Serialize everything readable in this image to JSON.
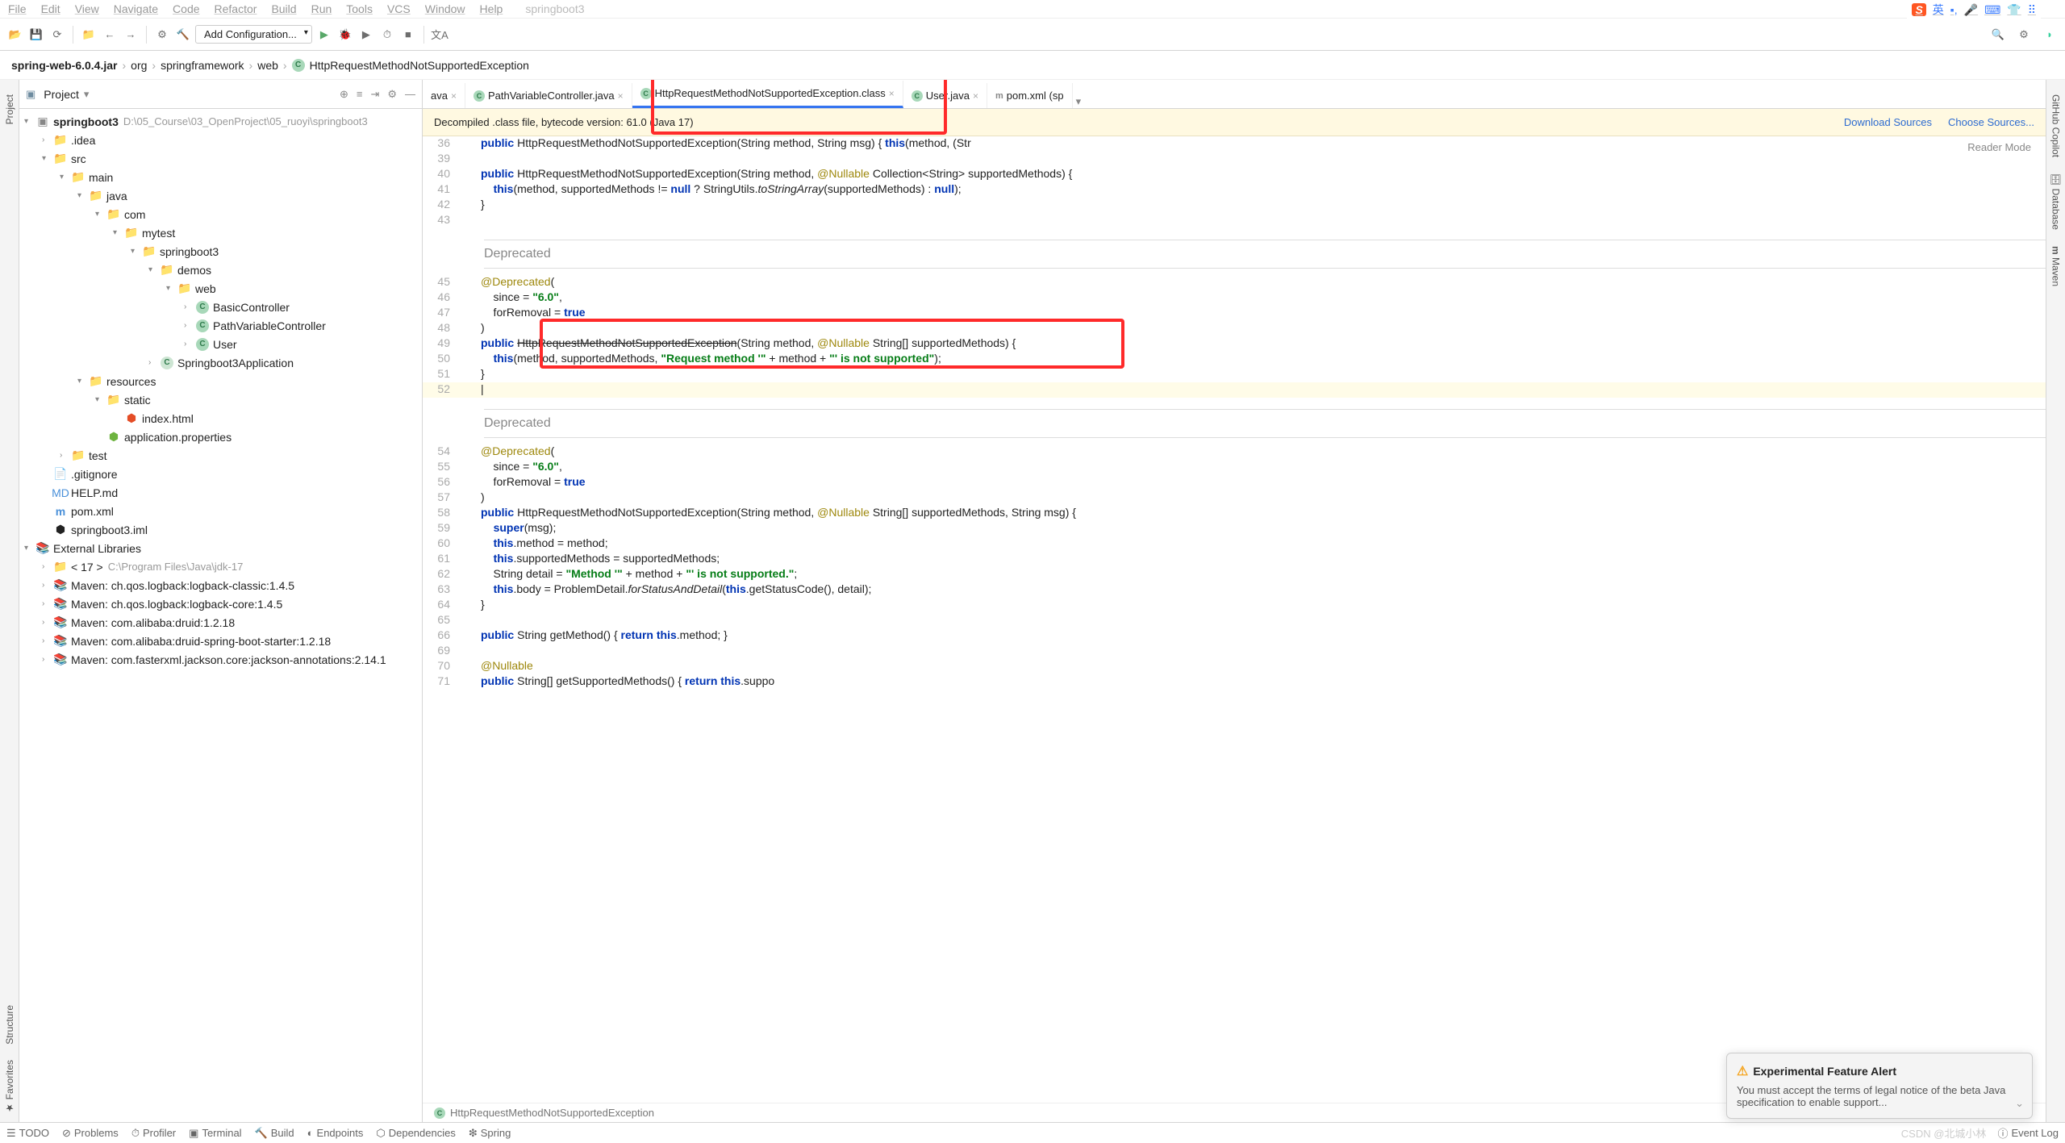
{
  "menubar": [
    "File",
    "Edit",
    "View",
    "Navigate",
    "Code",
    "Refactor",
    "Build",
    "Run",
    "Tools",
    "VCS",
    "Window",
    "Help"
  ],
  "menubar_title": "springboot3",
  "toolbar": {
    "config_label": "Add Configuration..."
  },
  "breadcrumb": [
    "spring-web-6.0.4.jar",
    "org",
    "springframework",
    "web"
  ],
  "breadcrumb_class": "HttpRequestMethodNotSupportedException",
  "panel": {
    "title": "Project"
  },
  "tree": {
    "root": "springboot3",
    "root_hint": "D:\\05_Course\\03_OpenProject\\05_ruoyi\\springboot3",
    "idea": ".idea",
    "src": "src",
    "main": "main",
    "java": "java",
    "com": "com",
    "mytest": "mytest",
    "sb3": "springboot3",
    "demos": "demos",
    "web": "web",
    "basic": "BasicController",
    "pathvar": "PathVariableController",
    "user": "User",
    "app": "Springboot3Application",
    "resources": "resources",
    "static": "static",
    "index": "index.html",
    "appprops": "application.properties",
    "test": "test",
    "gitignore": ".gitignore",
    "help": "HELP.md",
    "pom": "pom.xml",
    "iml": "springboot3.iml",
    "extlib": "External Libraries",
    "jdk": "< 17 >",
    "jdk_hint": "C:\\Program Files\\Java\\jdk-17",
    "m1": "Maven: ch.qos.logback:logback-classic:1.4.5",
    "m2": "Maven: ch.qos.logback:logback-core:1.4.5",
    "m3": "Maven: com.alibaba:druid:1.2.18",
    "m4": "Maven: com.alibaba:druid-spring-boot-starter:1.2.18",
    "m5": "Maven: com.fasterxml.jackson.core:jackson-annotations:2.14.1"
  },
  "tabs": {
    "t0": "ava",
    "t1": "PathVariableController.java",
    "t2": "HttpRequestMethodNotSupportedException.class",
    "t3": "User.java",
    "t4": "pom.xml (sp"
  },
  "banner": {
    "text_prefix": "Decompiled .class file, bytecode version: ",
    "text_version": "61.0 (Java 17)",
    "link1": "Download Sources",
    "link2": "Choose Sources..."
  },
  "reader_mode": "Reader Mode",
  "code_lines": {
    "36": "        public HttpRequestMethodNotSupportedException(String method, String msg) { this(method, (Str",
    "39": "",
    "40": "        public HttpRequestMethodNotSupportedException(String method, @Nullable Collection<String> supportedMethods) {",
    "41": "            this(method, supportedMethods != null ? StringUtils.toStringArray(supportedMethods) : null);",
    "42": "        }",
    "43": "",
    "dep1": "Deprecated",
    "45": "        @Deprecated(",
    "46": "            since = \"6.0\",",
    "47": "            forRemoval = true",
    "48": "        )",
    "49": "        public HttpRequestMethodNotSupportedException(String method, @Nullable String[] supportedMethods) {",
    "50": "            this(method, supportedMethods, \"Request method '\" + method + \"' is not supported\");",
    "51": "        }",
    "52": "",
    "dep2": "Deprecated",
    "54": "        @Deprecated(",
    "55": "            since = \"6.0\",",
    "56": "            forRemoval = true",
    "57": "        )",
    "58": "        public HttpRequestMethodNotSupportedException(String method, @Nullable String[] supportedMethods, String msg) {",
    "59": "            super(msg);",
    "60": "            this.method = method;",
    "61": "            this.supportedMethods = supportedMethods;",
    "62": "            String detail = \"Method '\" + method + \"' is not supported.\";",
    "63": "            this.body = ProblemDetail.forStatusAndDetail(this.getStatusCode(), detail);",
    "64": "        }",
    "65": "",
    "66": "        public String getMethod() { return this.method; }",
    "69": "",
    "70": "        @Nullable",
    "71": "        public String[] getSupportedMethods() { return this.suppo"
  },
  "editor_breadcrumb": "HttpRequestMethodNotSupportedException",
  "popup": {
    "title": "Experimental Feature Alert",
    "body": "You must accept the terms of legal notice of the beta Java specification to enable support..."
  },
  "statusbar": {
    "todo": "TODO",
    "problems": "Problems",
    "profiler": "Profiler",
    "terminal": "Terminal",
    "build": "Build",
    "endpoints": "Endpoints",
    "deps": "Dependencies",
    "spring": "Spring",
    "eventlog": "Event Log"
  },
  "watermark": "CSDN @北城小林",
  "right_panels": [
    "GitHub Copilot",
    "Database",
    "Maven"
  ],
  "left_panels": [
    "Project",
    "Structure",
    "Favorites"
  ],
  "ime": {
    "lang": "英"
  }
}
